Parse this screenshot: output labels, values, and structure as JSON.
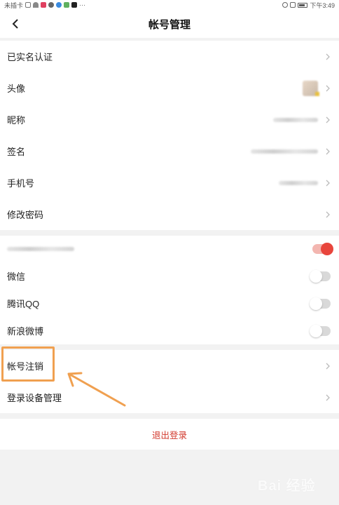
{
  "status_bar": {
    "carrier": "未插卡",
    "time": "下午3:49"
  },
  "header": {
    "title": "帐号管理",
    "back_icon": "chevron-left-icon"
  },
  "account_group": [
    {
      "label": "已实名认证",
      "value_type": "chevron"
    },
    {
      "label": "头像",
      "value_type": "avatar"
    },
    {
      "label": "昵称",
      "value_type": "blurred"
    },
    {
      "label": "签名",
      "value_type": "blurred"
    },
    {
      "label": "手机号",
      "value_type": "blurred"
    },
    {
      "label": "修改密码",
      "value_type": "chevron"
    }
  ],
  "binding_group": [
    {
      "label": "",
      "blurred": true,
      "toggle_on": true
    },
    {
      "label": "微信",
      "toggle_on": false
    },
    {
      "label": "腾讯QQ",
      "toggle_on": false
    },
    {
      "label": "新浪微博",
      "toggle_on": false
    }
  ],
  "manage_group": [
    {
      "label": "帐号注销"
    },
    {
      "label": "登录设备管理"
    }
  ],
  "logout_label": "退出登录",
  "watermark": "Bai 经验",
  "colors": {
    "accent": "#e8453c",
    "logout_text": "#d23a2e",
    "highlight": "#f0a050"
  }
}
